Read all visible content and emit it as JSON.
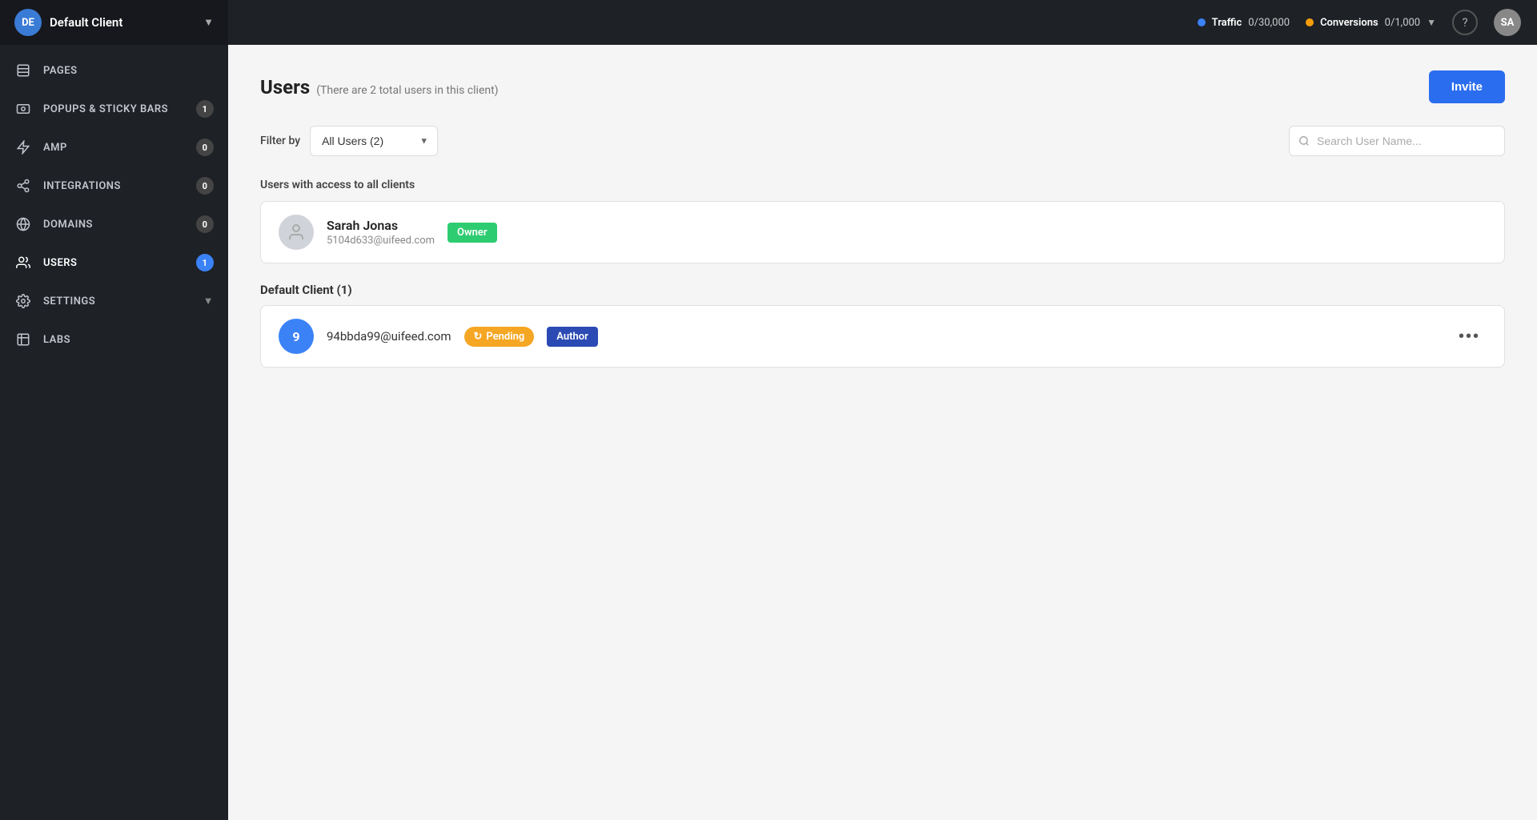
{
  "sidebar": {
    "client": {
      "initials": "DE",
      "name": "Default Client",
      "avatar_color": "#3a7bd5"
    },
    "nav_items": [
      {
        "id": "pages",
        "label": "PAGES",
        "icon": "pages-icon",
        "badge": null,
        "has_chevron": false
      },
      {
        "id": "popups",
        "label": "POPUPS & STICKY BARS",
        "icon": "popups-icon",
        "badge": "1",
        "badge_type": "gray",
        "has_chevron": false
      },
      {
        "id": "amp",
        "label": "AMP",
        "icon": "amp-icon",
        "badge": "0",
        "badge_type": "gray",
        "has_chevron": false
      },
      {
        "id": "integrations",
        "label": "INTEGRATIONS",
        "icon": "integrations-icon",
        "badge": "0",
        "badge_type": "gray",
        "has_chevron": false
      },
      {
        "id": "domains",
        "label": "DOMAINS",
        "icon": "domains-icon",
        "badge": "0",
        "badge_type": "gray",
        "has_chevron": false
      },
      {
        "id": "users",
        "label": "USERS",
        "icon": "users-icon",
        "badge": "1",
        "badge_type": "blue",
        "has_chevron": false,
        "active": true
      },
      {
        "id": "settings",
        "label": "SETTINGS",
        "icon": "settings-icon",
        "badge": null,
        "has_chevron": true
      },
      {
        "id": "labs",
        "label": "LABS",
        "icon": "labs-icon",
        "badge": null,
        "has_chevron": false
      }
    ]
  },
  "topbar": {
    "traffic": {
      "label": "Traffic",
      "value": "0/30,000",
      "dot_color": "#3b82f6"
    },
    "conversions": {
      "label": "Conversions",
      "value": "0/1,000",
      "dot_color": "#f59e0b"
    },
    "help_icon": "?",
    "user_initials": "SA"
  },
  "page": {
    "title": "Users",
    "subtitle": "(There are 2 total users in this client)",
    "invite_button": "Invite"
  },
  "filter": {
    "label": "Filter by",
    "select_value": "All Users (2)",
    "select_options": [
      "All Users (2)"
    ],
    "search_placeholder": "Search User Name..."
  },
  "sections": {
    "global_title": "Users with access to all clients",
    "global_users": [
      {
        "name": "Sarah Jonas",
        "email": "5104d633@uifeed.com",
        "avatar_initials": null,
        "badge_type": "owner",
        "badge_label": "Owner"
      }
    ],
    "client_section_title": "Default Client",
    "client_section_count": "(1)",
    "client_users": [
      {
        "email": "94bbda99@uifeed.com",
        "avatar_initials": "9",
        "avatar_color": "#3b82f6",
        "status_badge": "Pending",
        "role_badge": "Author"
      }
    ]
  }
}
